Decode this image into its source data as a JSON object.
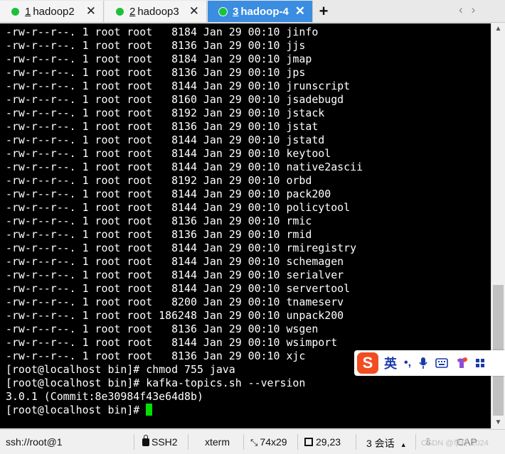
{
  "tabs": [
    {
      "num": "1",
      "label": "hadoop2",
      "active": false
    },
    {
      "num": "2",
      "label": "hadoop3",
      "active": false
    },
    {
      "num": "3",
      "label": "hadoop-4",
      "active": true
    }
  ],
  "new_tab_label": "+",
  "terminal": {
    "lines": [
      "-rw-r--r--. 1 root root   8184 Jan 29 00:10 jinfo",
      "-rw-r--r--. 1 root root   8136 Jan 29 00:10 jjs",
      "-rw-r--r--. 1 root root   8184 Jan 29 00:10 jmap",
      "-rw-r--r--. 1 root root   8136 Jan 29 00:10 jps",
      "-rw-r--r--. 1 root root   8144 Jan 29 00:10 jrunscript",
      "-rw-r--r--. 1 root root   8160 Jan 29 00:10 jsadebugd",
      "-rw-r--r--. 1 root root   8192 Jan 29 00:10 jstack",
      "-rw-r--r--. 1 root root   8136 Jan 29 00:10 jstat",
      "-rw-r--r--. 1 root root   8144 Jan 29 00:10 jstatd",
      "-rw-r--r--. 1 root root   8144 Jan 29 00:10 keytool",
      "-rw-r--r--. 1 root root   8144 Jan 29 00:10 native2ascii",
      "-rw-r--r--. 1 root root   8192 Jan 29 00:10 orbd",
      "-rw-r--r--. 1 root root   8144 Jan 29 00:10 pack200",
      "-rw-r--r--. 1 root root   8144 Jan 29 00:10 policytool",
      "-rw-r--r--. 1 root root   8136 Jan 29 00:10 rmic",
      "-rw-r--r--. 1 root root   8136 Jan 29 00:10 rmid",
      "-rw-r--r--. 1 root root   8144 Jan 29 00:10 rmiregistry",
      "-rw-r--r--. 1 root root   8144 Jan 29 00:10 schemagen",
      "-rw-r--r--. 1 root root   8144 Jan 29 00:10 serialver",
      "-rw-r--r--. 1 root root   8144 Jan 29 00:10 servertool",
      "-rw-r--r--. 1 root root   8200 Jan 29 00:10 tnameserv",
      "-rw-r--r--. 1 root root 186248 Jan 29 00:10 unpack200",
      "-rw-r--r--. 1 root root   8136 Jan 29 00:10 wsgen",
      "-rw-r--r--. 1 root root   8144 Jan 29 00:10 wsimport",
      "-rw-r--r--. 1 root root   8136 Jan 29 00:10 xjc",
      "[root@localhost bin]# chmod 755 java",
      "[root@localhost bin]# kafka-topics.sh --version",
      "3.0.1 (Commit:8e30984f43e64d8b)"
    ],
    "prompt": "[root@localhost bin]# ",
    "cursor_color": "#00e000"
  },
  "ime": {
    "logo": "S",
    "lang": "英",
    "punct": "•,",
    "icons": [
      "mic-icon",
      "keyboard-icon",
      "skin-icon",
      "grid-icon"
    ]
  },
  "statusbar": {
    "connection": "ssh://root@1",
    "protocol": "SSH2",
    "terminal_type": "xterm",
    "size": "74x29",
    "cursor_pos": "29,23",
    "sessions": "3 会话",
    "caps": "CAP"
  },
  "watermark": "CSDN @李仟 2024",
  "colors": {
    "active_tab": "#3a8de0",
    "status_dot": "#1fbf3a",
    "terminal_bg": "#000000",
    "ime_logo": "#f04d22"
  }
}
